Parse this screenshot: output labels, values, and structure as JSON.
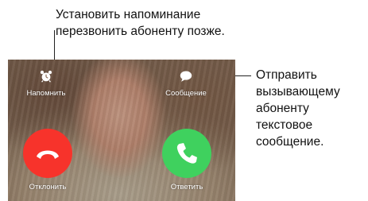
{
  "callouts": {
    "remind": {
      "line1": "Установить напоминание",
      "line2": "перезвонить абоненту позже."
    },
    "message": {
      "line1": "Отправить",
      "line2": "вызывающему",
      "line3": "абоненту",
      "line4": "текстовое",
      "line5": "сообщение."
    }
  },
  "call_screen": {
    "remind_label": "Напомнить",
    "remind_icon": "alarm-clock-icon",
    "message_label": "Сообщение",
    "message_icon": "speech-bubble-icon",
    "decline_label": "Отклонить",
    "decline_icon": "hang-up-phone-icon",
    "decline_color": "#f7332b",
    "accept_label": "Ответить",
    "accept_icon": "phone-handset-icon",
    "accept_color": "#3fd15e"
  }
}
